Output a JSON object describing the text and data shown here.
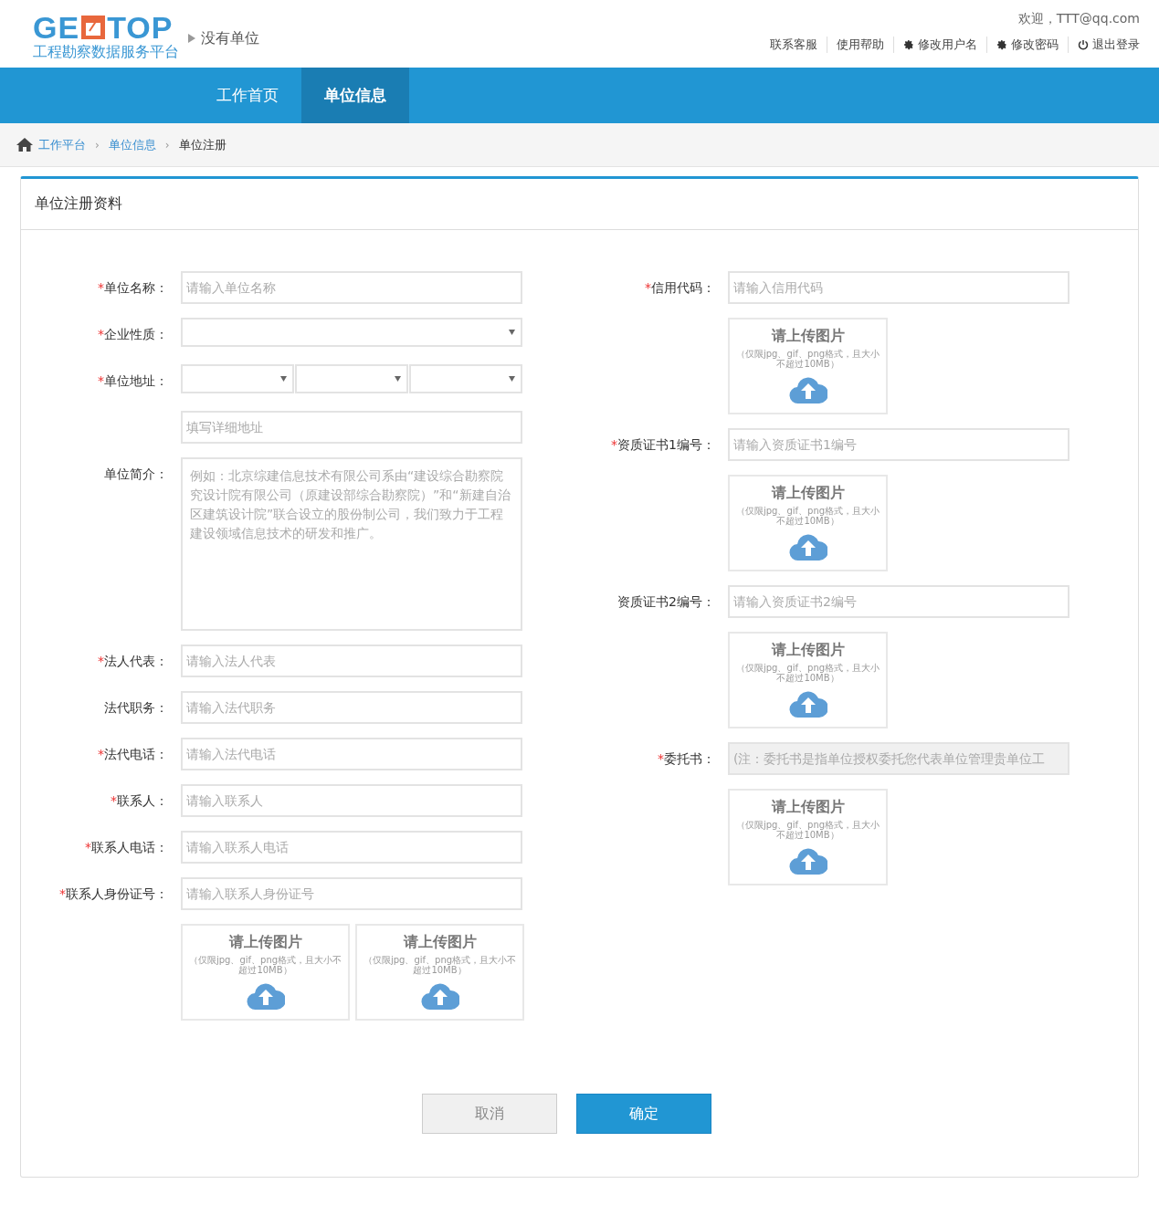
{
  "header": {
    "logo": {
      "left": "GE",
      "right": "TOP",
      "subtitle": "工程勘察数据服务平台"
    },
    "unit": "没有单位",
    "welcome": "欢迎，TTT@qq.com",
    "links": [
      {
        "label": "联系客服",
        "kind": "text"
      },
      {
        "label": "使用帮助",
        "kind": "text"
      },
      {
        "label": "修改用户名",
        "kind": "settings"
      },
      {
        "label": "修改密码",
        "kind": "settings"
      },
      {
        "label": "退出登录",
        "kind": "logout"
      }
    ]
  },
  "nav": [
    {
      "label": "工作首页",
      "selected": false
    },
    {
      "label": "单位信息",
      "selected": true
    }
  ],
  "breadcrumb": [
    {
      "label": "工作平台",
      "kind": "link"
    },
    {
      "separator": "›",
      "label": "单位信息",
      "kind": "link"
    },
    {
      "separator": "›",
      "label": "单位注册",
      "kind": "current"
    }
  ],
  "panel": {
    "title": "单位注册资料",
    "left_fields": [
      {
        "kind": "input",
        "mark": "*",
        "label": "单位名称：",
        "placeholder": "请输入单位名称"
      },
      {
        "kind": "select",
        "mark": "*",
        "label": "企业性质："
      },
      {
        "kind": "address",
        "mark": "*",
        "label": "单位地址："
      },
      {
        "kind": "input",
        "placeholder": "填写详细地址"
      },
      {
        "kind": "textarea",
        "label": "单位简介：",
        "placeholder": "例如：北京综建信息技术有限公司系由“建设综合勘察院究设计院有限公司（原建设部综合勘察院）”和“新建自治区建筑设计院”联合设立的股份制公司，我们致力于工程建设领域信息技术的研发和推广。"
      },
      {
        "kind": "input",
        "mark": "*",
        "label": "法人代表：",
        "placeholder": "请输入法人代表"
      },
      {
        "kind": "input",
        "label": "法代职务：",
        "placeholder": "请输入法代职务"
      },
      {
        "kind": "input",
        "mark": "*",
        "label": "法代电话：",
        "placeholder": "请输入法代电话"
      },
      {
        "kind": "input",
        "mark": "*",
        "label": "联系人：",
        "placeholder": "请输入联系人"
      },
      {
        "kind": "input",
        "mark": "*",
        "label": "联系人电话：",
        "placeholder": "请输入联系人电话"
      },
      {
        "kind": "input",
        "mark": "*",
        "label": "联系人身份证号：",
        "placeholder": "请输入联系人身份证号"
      },
      {
        "kind": "uploads",
        "items": [
          {
            "title": "请上传图片",
            "hint": "（仅限jpg、gif、png格式，且大小不超过10MB）"
          },
          {
            "title": "请上传图片",
            "hint": "（仅限jpg、gif、png格式，且大小不超过10MB）"
          }
        ]
      }
    ],
    "right_fields": [
      {
        "kind": "input",
        "mark": "*",
        "label": "信用代码：",
        "placeholder": "请输入信用代码",
        "disabled": false
      },
      {
        "kind": "upload",
        "title": "请上传图片",
        "hint": "（仅限jpg、gif、png格式，且大小不超过10MB）"
      },
      {
        "kind": "input",
        "mark": "*",
        "label": "资质证书1编号：",
        "placeholder": "请输入资质证书1编号",
        "disabled": false
      },
      {
        "kind": "upload",
        "title": "请上传图片",
        "hint": "（仅限jpg、gif、png格式，且大小不超过10MB）"
      },
      {
        "kind": "input",
        "label": "资质证书2编号：",
        "placeholder": "请输入资质证书2编号",
        "disabled": false
      },
      {
        "kind": "upload",
        "title": "请上传图片",
        "hint": "（仅限jpg、gif、png格式，且大小不超过10MB）"
      },
      {
        "kind": "input",
        "mark": "*",
        "label": "委托书：",
        "placeholder": "(注：委托书是指单位授权委托您代表单位管理贵单位工",
        "disabled": true
      },
      {
        "kind": "upload",
        "title": "请上传图片",
        "hint": "（仅限jpg、gif、png格式，且大小不超过10MB）"
      }
    ],
    "buttons": [
      {
        "label": "取消",
        "kind": "cancel"
      },
      {
        "label": "确定",
        "kind": "confirm"
      }
    ]
  }
}
